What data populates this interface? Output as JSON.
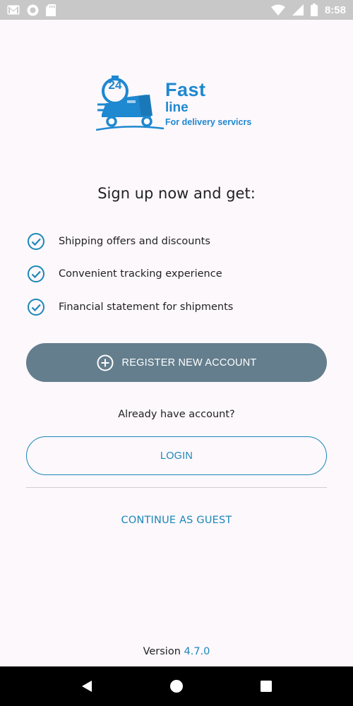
{
  "status_bar": {
    "time": "8:58",
    "icons": [
      "gmail-icon",
      "sync-icon",
      "sd-card-icon",
      "wifi-icon",
      "signal-icon",
      "battery-icon"
    ]
  },
  "logo": {
    "badge": "24",
    "word1": "Fast",
    "word2": "line",
    "tagline": "For delivery servicrs",
    "color": "#1e88d0"
  },
  "headline": "Sign up now and get:",
  "benefits": [
    {
      "label": "Shipping offers and discounts",
      "icon": "check-circle-icon"
    },
    {
      "label": "Convenient tracking experience",
      "icon": "check-circle-icon"
    },
    {
      "label": "Financial statement for shipments",
      "icon": "check-circle-icon"
    }
  ],
  "register_button": {
    "label": "REGISTER NEW ACCOUNT",
    "icon": "plus-circle-icon",
    "color": "#647e8d"
  },
  "already_text": "Already have account?",
  "login_button": {
    "label": "LOGIN",
    "color": "#1b87b8"
  },
  "guest_link": {
    "label": "CONTINUE AS GUEST"
  },
  "version": {
    "prefix": "Version",
    "number": "4.7.0"
  },
  "nav_bar": {
    "icons": [
      "back-icon",
      "home-icon",
      "recents-icon"
    ]
  }
}
